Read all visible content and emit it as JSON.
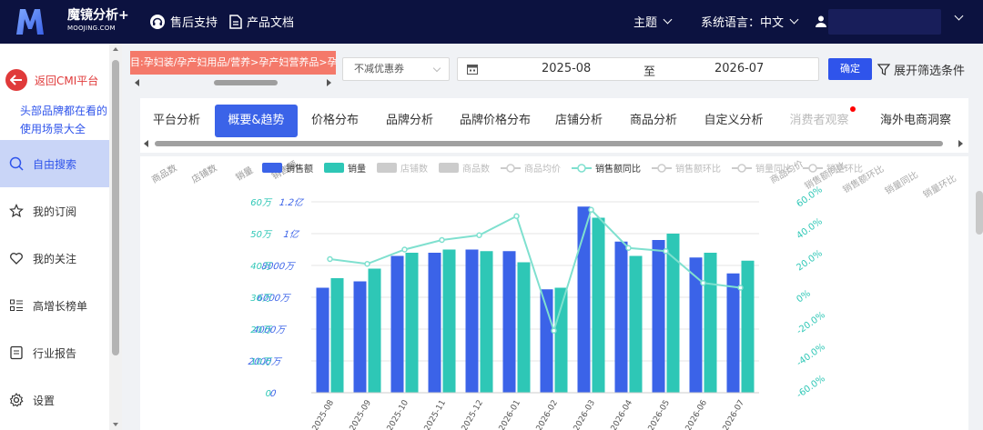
{
  "brand": {
    "name": "魔镜分析+",
    "sub": "MOOJING.COM",
    "logo_letter": "M"
  },
  "top_nav": {
    "support": "售后支持",
    "docs": "产品文档",
    "theme": "主题",
    "language": "系统语言：中文"
  },
  "sidebar": {
    "back": "返回CMI平台",
    "scenario_line1": "头部品牌都在看的",
    "scenario_line2": "使用场景大全",
    "items": [
      {
        "label": "自由搜索",
        "icon": "search-icon",
        "active": true
      },
      {
        "label": "我的订阅",
        "icon": "star-icon",
        "active": false
      },
      {
        "label": "我的关注",
        "icon": "heart-icon",
        "active": false
      },
      {
        "label": "高增长榜单",
        "icon": "list-icon",
        "active": false
      },
      {
        "label": "行业报告",
        "icon": "report-icon",
        "active": false
      },
      {
        "label": "设置",
        "icon": "gear-icon",
        "active": false
      }
    ]
  },
  "filters": {
    "category": "目:孕妇装/孕产妇用品/营养>孕产妇营养品>孕产妇",
    "coupon": "不减优惠券",
    "date_start": "2025-08",
    "date_sep": "至",
    "date_end": "2026-07",
    "confirm": "确定",
    "expand": "展开筛选条件"
  },
  "tabs": [
    {
      "label": "平台分析",
      "active": false,
      "disabled": false
    },
    {
      "label": "概要&趋势",
      "active": true,
      "disabled": false
    },
    {
      "label": "价格分布",
      "active": false,
      "disabled": false
    },
    {
      "label": "品牌分析",
      "active": false,
      "disabled": false
    },
    {
      "label": "品牌价格分布",
      "active": false,
      "disabled": false
    },
    {
      "label": "店铺分析",
      "active": false,
      "disabled": false
    },
    {
      "label": "商品分析",
      "active": false,
      "disabled": false
    },
    {
      "label": "自定义分析",
      "active": false,
      "disabled": false
    },
    {
      "label": "消费者观察",
      "active": false,
      "disabled": true
    },
    {
      "label": "海外电商洞察",
      "active": false,
      "disabled": false
    }
  ],
  "chart_data": {
    "type": "bar",
    "categories": [
      "2025-08",
      "2025-09",
      "2025-10",
      "2025-11",
      "2025-12",
      "2026-01",
      "2026-02",
      "2026-03",
      "2026-04",
      "2026-05",
      "2026-06",
      "2026-07"
    ],
    "legend": [
      {
        "name": "销售额",
        "on": true,
        "color": "#3b63e8",
        "kind": "box"
      },
      {
        "name": "销量",
        "on": true,
        "color": "#2ec7b6",
        "kind": "box"
      },
      {
        "name": "店铺数",
        "on": false,
        "color": "#cccccc",
        "kind": "box"
      },
      {
        "name": "商品数",
        "on": false,
        "color": "#cccccc",
        "kind": "box"
      },
      {
        "name": "商品均价",
        "on": false,
        "color": "#cccccc",
        "kind": "line"
      },
      {
        "name": "销售额同比",
        "on": true,
        "color": "#7fe0cf",
        "kind": "line"
      },
      {
        "name": "销售额环比",
        "on": false,
        "color": "#cccccc",
        "kind": "line"
      },
      {
        "name": "销量同比",
        "on": false,
        "color": "#cccccc",
        "kind": "line"
      },
      {
        "name": "销量环比",
        "on": false,
        "color": "#cccccc",
        "kind": "line"
      }
    ],
    "series": [
      {
        "name": "销售额",
        "axis": "sales",
        "values": [
          66000000,
          70000000,
          86000000,
          88000000,
          90000000,
          89000000,
          65000000,
          117000000,
          95000000,
          96000000,
          85000000,
          75000000
        ]
      },
      {
        "name": "销量",
        "axis": "volume",
        "values": [
          360000,
          390000,
          440000,
          450000,
          445000,
          410000,
          330000,
          550000,
          430000,
          500000,
          440000,
          415000
        ]
      },
      {
        "name": "销售额同比",
        "axis": "yoy",
        "values": [
          0.24,
          0.21,
          0.3,
          0.36,
          0.39,
          0.51,
          -0.21,
          0.55,
          0.31,
          0.29,
          0.09,
          0.06
        ]
      }
    ],
    "axes": {
      "sales": {
        "ticks": [
          "0",
          "2000万",
          "4000万",
          "6000万",
          "8000万",
          "1亿",
          "1.2亿"
        ],
        "max": 120000000,
        "color": "#3b63e8"
      },
      "volume": {
        "ticks": [
          "0",
          "10万",
          "20万",
          "30万",
          "40万",
          "50万",
          "60万"
        ],
        "max": 600000,
        "color": "#2ec7b6"
      },
      "yoy": {
        "ticks": [
          "-60.0%",
          "-40.0%",
          "-20.0%",
          "0%",
          "20.0%",
          "40.0%",
          "60.0%"
        ],
        "min": -0.6,
        "max": 0.6,
        "color": "#2ec7b6"
      }
    },
    "faded_axis_titles_left": [
      "商品数",
      "店铺数",
      "销量",
      "销售额"
    ],
    "faded_axis_titles_right": [
      "商品均价",
      "销售额同比",
      "销售额环比",
      "销量同比",
      "销量环比"
    ]
  }
}
